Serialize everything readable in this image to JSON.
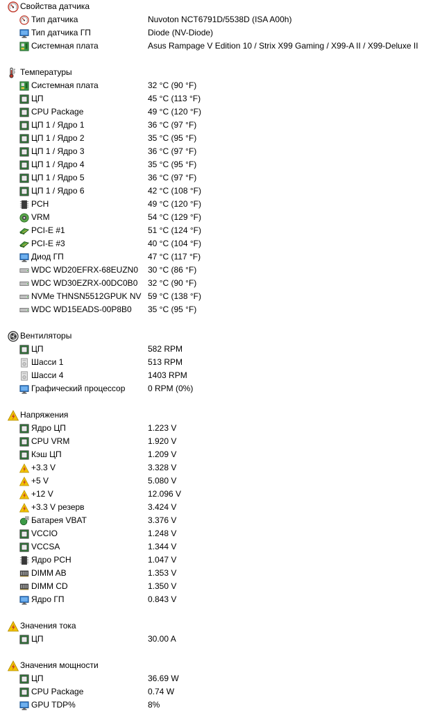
{
  "sections": [
    {
      "title": "Свойства датчика",
      "icon": "sensor-gauge-icon",
      "items": [
        {
          "label": "Тип датчика",
          "value": "Nuvoton NCT6791D/5538D  (ISA A00h)",
          "icon": "sensor-gauge-icon"
        },
        {
          "label": "Тип датчика ГП",
          "value": "Diode  (NV-Diode)",
          "icon": "monitor-icon"
        },
        {
          "label": "Системная плата",
          "value": "Asus Rampage V Edition 10 / Strix X99 Gaming / X99-A II / X99-Deluxe II",
          "icon": "motherboard-icon"
        }
      ]
    },
    {
      "title": "Температуры",
      "icon": "thermometer-icon",
      "items": [
        {
          "label": "Системная плата",
          "value": "32 °C  (90 °F)",
          "icon": "motherboard-icon"
        },
        {
          "label": "ЦП",
          "value": "45 °C  (113 °F)",
          "icon": "cpu-chip-icon"
        },
        {
          "label": "CPU Package",
          "value": "49 °C  (120 °F)",
          "icon": "cpu-chip-icon"
        },
        {
          "label": "ЦП 1 / Ядро 1",
          "value": "36 °C  (97 °F)",
          "icon": "cpu-chip-icon"
        },
        {
          "label": "ЦП 1 / Ядро 2",
          "value": "35 °C  (95 °F)",
          "icon": "cpu-chip-icon"
        },
        {
          "label": "ЦП 1 / Ядро 3",
          "value": "36 °C  (97 °F)",
          "icon": "cpu-chip-icon"
        },
        {
          "label": "ЦП 1 / Ядро 4",
          "value": "35 °C  (95 °F)",
          "icon": "cpu-chip-icon"
        },
        {
          "label": "ЦП 1 / Ядро 5",
          "value": "36 °C  (97 °F)",
          "icon": "cpu-chip-icon"
        },
        {
          "label": "ЦП 1 / Ядро 6",
          "value": "42 °C  (108 °F)",
          "icon": "cpu-chip-icon"
        },
        {
          "label": "PCH",
          "value": "49 °C  (120 °F)",
          "icon": "chip-dark-icon"
        },
        {
          "label": "VRM",
          "value": "54 °C  (129 °F)",
          "icon": "vrm-icon"
        },
        {
          "label": "PCI-E #1",
          "value": "51 °C  (124 °F)",
          "icon": "pcie-card-icon"
        },
        {
          "label": "PCI-E #3",
          "value": "40 °C  (104 °F)",
          "icon": "pcie-card-icon"
        },
        {
          "label": "Диод ГП",
          "value": "47 °C  (117 °F)",
          "icon": "monitor-icon"
        },
        {
          "label": "WDC WD20EFRX-68EUZN0",
          "value": "30 °C  (86 °F)",
          "icon": "hard-drive-icon"
        },
        {
          "label": "WDC WD30EZRX-00DC0B0",
          "value": "32 °C  (90 °F)",
          "icon": "hard-drive-icon"
        },
        {
          "label": "NVMe THNSN5512GPUK NV",
          "value": "59 °C  (138 °F)",
          "icon": "hard-drive-icon"
        },
        {
          "label": "WDC WD15EADS-00P8B0",
          "value": "35 °C  (95 °F)",
          "icon": "hard-drive-icon"
        }
      ]
    },
    {
      "title": "Вентиляторы",
      "icon": "fan-icon",
      "items": [
        {
          "label": "ЦП",
          "value": "582 RPM",
          "icon": "cpu-chip-icon"
        },
        {
          "label": "Шасси 1",
          "value": "513 RPM",
          "icon": "chassis-icon"
        },
        {
          "label": "Шасси 4",
          "value": "1403 RPM",
          "icon": "chassis-icon"
        },
        {
          "label": "Графический процессор",
          "value": "0 RPM  (0%)",
          "icon": "monitor-icon"
        }
      ]
    },
    {
      "title": "Напряжения",
      "icon": "warning-bolt-icon",
      "items": [
        {
          "label": "Ядро ЦП",
          "value": "1.223 V",
          "icon": "cpu-chip-icon"
        },
        {
          "label": "CPU VRM",
          "value": "1.920 V",
          "icon": "cpu-chip-icon"
        },
        {
          "label": "Кэш ЦП",
          "value": "1.209 V",
          "icon": "cpu-chip-icon"
        },
        {
          "label": "+3.3 V",
          "value": "3.328 V",
          "icon": "warning-bolt-icon"
        },
        {
          "label": "+5 V",
          "value": "5.080 V",
          "icon": "warning-bolt-icon"
        },
        {
          "label": "+12 V",
          "value": "12.096 V",
          "icon": "warning-bolt-icon"
        },
        {
          "label": "+3.3 V резерв",
          "value": "3.424 V",
          "icon": "warning-bolt-icon"
        },
        {
          "label": "Батарея VBAT",
          "value": "3.376 V",
          "icon": "battery-icon"
        },
        {
          "label": "VCCIO",
          "value": "1.248 V",
          "icon": "cpu-chip-icon"
        },
        {
          "label": "VCCSA",
          "value": "1.344 V",
          "icon": "cpu-chip-icon"
        },
        {
          "label": "Ядро PCH",
          "value": "1.047 V",
          "icon": "chip-dark-icon"
        },
        {
          "label": "DIMM AB",
          "value": "1.353 V",
          "icon": "memory-module-icon"
        },
        {
          "label": "DIMM CD",
          "value": "1.350 V",
          "icon": "memory-module-icon"
        },
        {
          "label": "Ядро ГП",
          "value": "0.843 V",
          "icon": "monitor-icon"
        }
      ]
    },
    {
      "title": "Значения тока",
      "icon": "warning-bolt-icon",
      "items": [
        {
          "label": "ЦП",
          "value": "30.00 A",
          "icon": "cpu-chip-icon"
        }
      ]
    },
    {
      "title": "Значения мощности",
      "icon": "warning-bolt-icon",
      "items": [
        {
          "label": "ЦП",
          "value": "36.69 W",
          "icon": "cpu-chip-icon"
        },
        {
          "label": "CPU Package",
          "value": "0.74 W",
          "icon": "cpu-chip-icon"
        },
        {
          "label": "GPU TDP%",
          "value": "8%",
          "icon": "monitor-icon"
        }
      ]
    }
  ],
  "colors": {
    "chip_green": "#2f8a3a",
    "chip_dark": "#333333",
    "warning_yellow": "#f2c200",
    "monitor_blue": "#2f78c8",
    "gauge_red": "#c0392b"
  }
}
